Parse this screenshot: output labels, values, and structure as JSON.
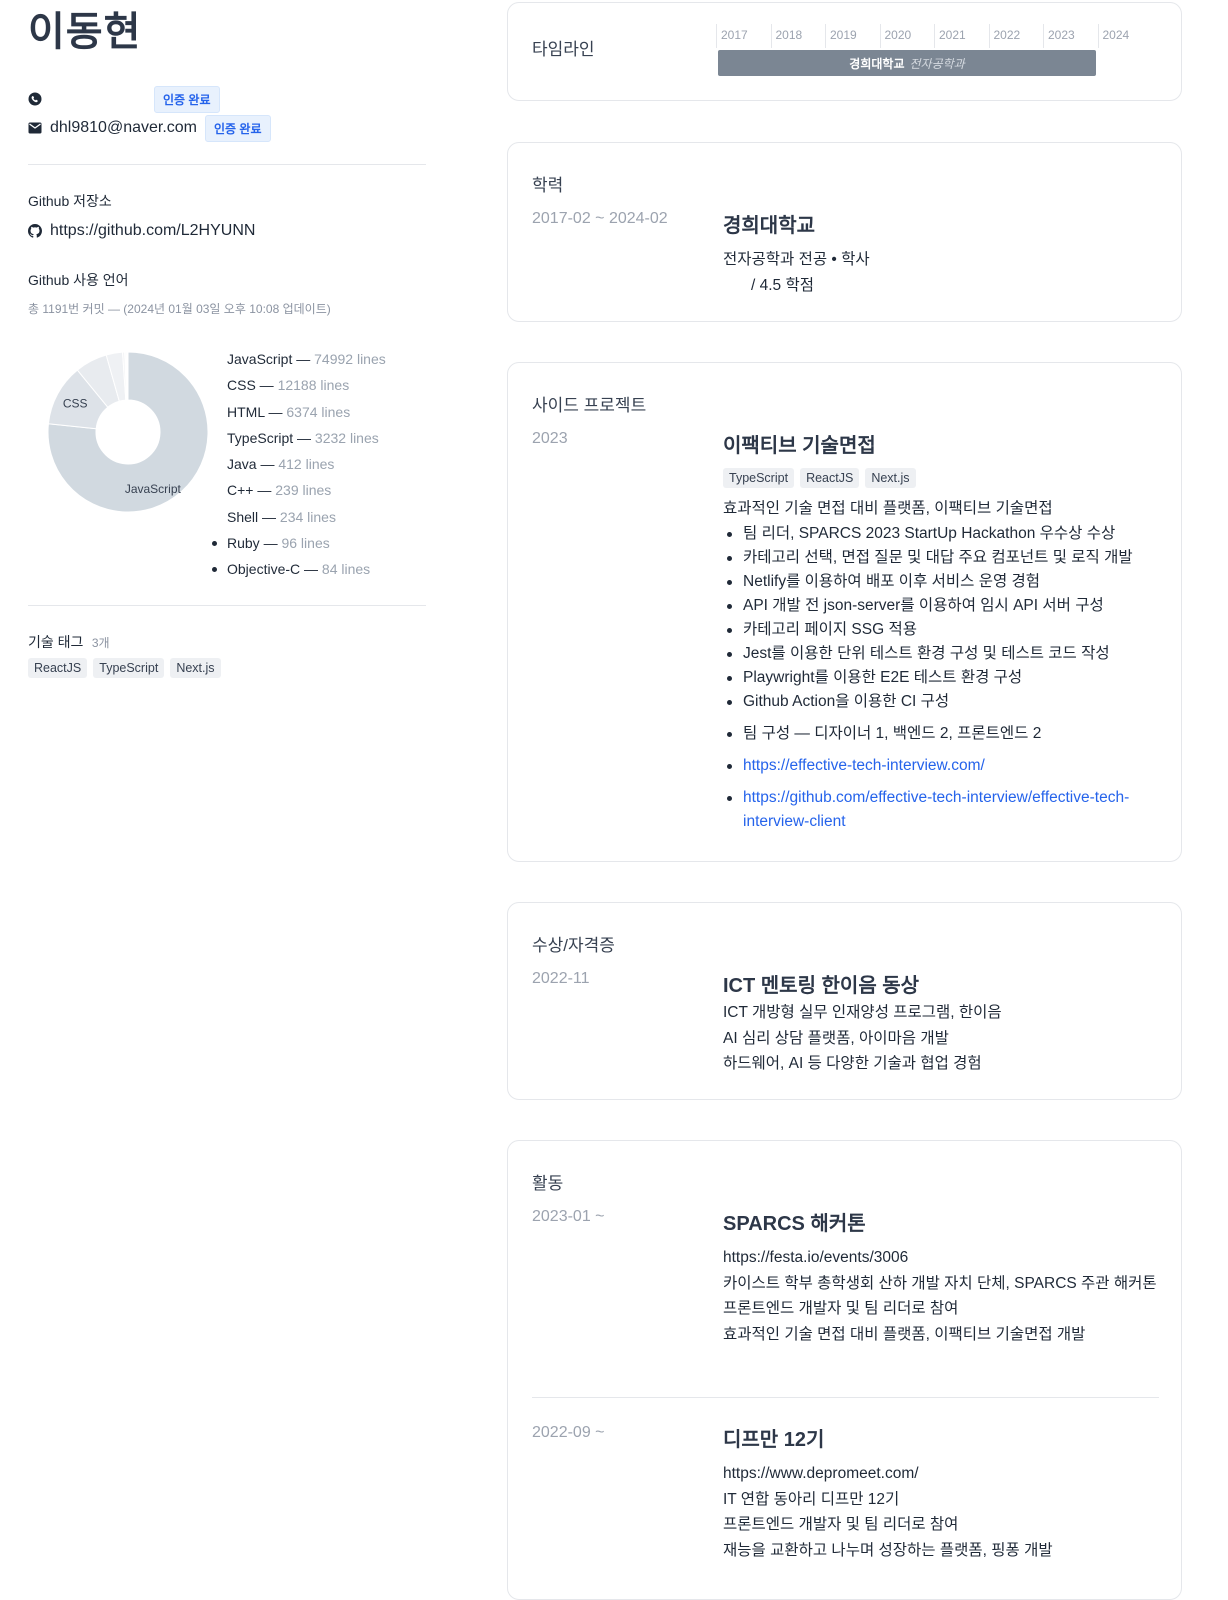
{
  "profile": {
    "name": "이동현",
    "phone_verified": "인증 완료",
    "email": "dhl9810@naver.com",
    "email_verified": "인증 완료"
  },
  "github": {
    "repo_label": "Github 저장소",
    "repo_url": "https://github.com/L2HYUNN",
    "lang_label": "Github 사용 언어",
    "commit_summary": "총 1191번 커밋 — (2024년 01월 03일 오후 10:08 업데이트)",
    "languages": [
      {
        "name": "JavaScript",
        "sep": " — ",
        "lines": "74992 lines"
      },
      {
        "name": "CSS",
        "sep": " — ",
        "lines": "12188 lines"
      },
      {
        "name": "HTML",
        "sep": " — ",
        "lines": "6374 lines"
      },
      {
        "name": "TypeScript",
        "sep": " — ",
        "lines": "3232 lines"
      },
      {
        "name": "Java",
        "sep": " — ",
        "lines": "412 lines"
      },
      {
        "name": "C++",
        "sep": " — ",
        "lines": "239 lines"
      },
      {
        "name": "Shell",
        "sep": " — ",
        "lines": "234 lines"
      },
      {
        "name": "Ruby",
        "sep": " — ",
        "lines": "96 lines"
      },
      {
        "name": "Objective-C",
        "sep": " — ",
        "lines": "84 lines"
      }
    ]
  },
  "chart_data": {
    "type": "pie",
    "categories": [
      "JavaScript",
      "CSS",
      "HTML",
      "TypeScript",
      "Java",
      "C++",
      "Shell",
      "Ruby",
      "Objective-C"
    ],
    "values": [
      74992,
      12188,
      6374,
      3232,
      412,
      239,
      234,
      96,
      84
    ],
    "title": "",
    "slice_labels": [
      "JavaScript",
      "CSS"
    ]
  },
  "skills": {
    "label": "기술 태그",
    "count": "3개",
    "tags": [
      "ReactJS",
      "TypeScript",
      "Next.js"
    ]
  },
  "timeline": {
    "title": "타임라인",
    "years": [
      "2017",
      "2018",
      "2019",
      "2020",
      "2021",
      "2022",
      "2023",
      "2024"
    ],
    "bar_school": "경희대학교",
    "bar_major": "전자공학과"
  },
  "education": {
    "title": "학력",
    "date": "2017-02 ~ 2024-02",
    "school": "경희대학교",
    "degree": "전자공학과 전공 • 학사",
    "gpa": "/ 4.5 학점"
  },
  "projects": {
    "title": "사이드 프로젝트",
    "date": "2023",
    "name": "이팩티브 기술면접",
    "tags": [
      "TypeScript",
      "ReactJS",
      "Next.js"
    ],
    "summary": "효과적인 기술 면접 대비 플랫폼, 이팩티브 기술면접",
    "bullets": [
      "팀 리더, SPARCS 2023 StartUp Hackathon 우수상 수상",
      "카테고리 선택, 면접 질문 및 대답 주요 컴포넌트 및 로직 개발",
      "Netlify를 이용하여 배포 이후 서비스 운영 경험",
      "API 개발 전 json-server를 이용하여 임시 API 서버 구성",
      "카테고리 페이지 SSG 적용",
      "Jest를 이용한 단위 테스트 환경 구성 및 테스트 코드 작성",
      "Playwright를 이용한 E2E 테스트 환경 구성",
      "Github Action을 이용한 CI 구성"
    ],
    "team": "팀 구성 — 디자이너 1, 백엔드 2, 프론트엔드 2",
    "link1": "https://effective-tech-interview.com/",
    "link2": "https://github.com/effective-tech-interview/effective-tech-interview-client"
  },
  "awards": {
    "title": "수상/자격증",
    "date": "2022-11",
    "name": "ICT 멘토링 한이음 동상",
    "line1": "ICT 개방형 실무 인재양성 프로그램, 한이음",
    "line2": "AI 심리 상담 플랫폼, 아이마음 개발",
    "line3": "하드웨어, AI 등 다양한 기술과 협업 경험"
  },
  "activities": {
    "title": "활동",
    "items": [
      {
        "date": "2023-01 ~",
        "name": "SPARCS 해커톤",
        "url": "https://festa.io/events/3006",
        "line1": "카이스트 학부 총학생회 산하 개발 자치 단체, SPARCS 주관 해커톤",
        "line2": "프론트엔드 개발자 및 팀 리더로 참여",
        "line3": "효과적인 기술 면접 대비 플랫폼, 이팩티브 기술면접 개발"
      },
      {
        "date": "2022-09 ~",
        "name": "디프만 12기",
        "url": "https://www.depromeet.com/",
        "line1": "IT 연합 동아리 디프만 12기",
        "line2": "프론트엔드 개발자 및 팀 리더로 참여",
        "line3": "재능을 교환하고 나누며 성장하는 플랫폼, 핑퐁 개발"
      }
    ]
  }
}
